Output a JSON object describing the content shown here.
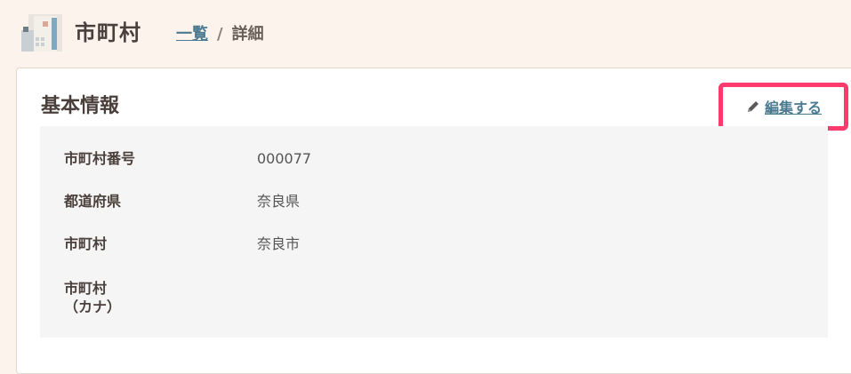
{
  "header": {
    "title": "市町村",
    "breadcrumb": {
      "list_link": "一覧",
      "separator": "/",
      "current": "詳細"
    }
  },
  "section": {
    "title": "基本情報",
    "edit_label": "編集する"
  },
  "fields": [
    {
      "label": "市町村番号",
      "value": "000077"
    },
    {
      "label": "都道府県",
      "value": "奈良県"
    },
    {
      "label": "市町村",
      "value": "奈良市"
    },
    {
      "label_line1": "市町村",
      "label_line2": "（カナ）",
      "value": ""
    }
  ],
  "colors": {
    "page_bg": "#fcf3ec",
    "link": "#4a7a90",
    "highlight": "#ff3b6e",
    "panel_bg": "#f5f5f5"
  },
  "icons": [
    "city-building-icon",
    "pencil-icon"
  ]
}
